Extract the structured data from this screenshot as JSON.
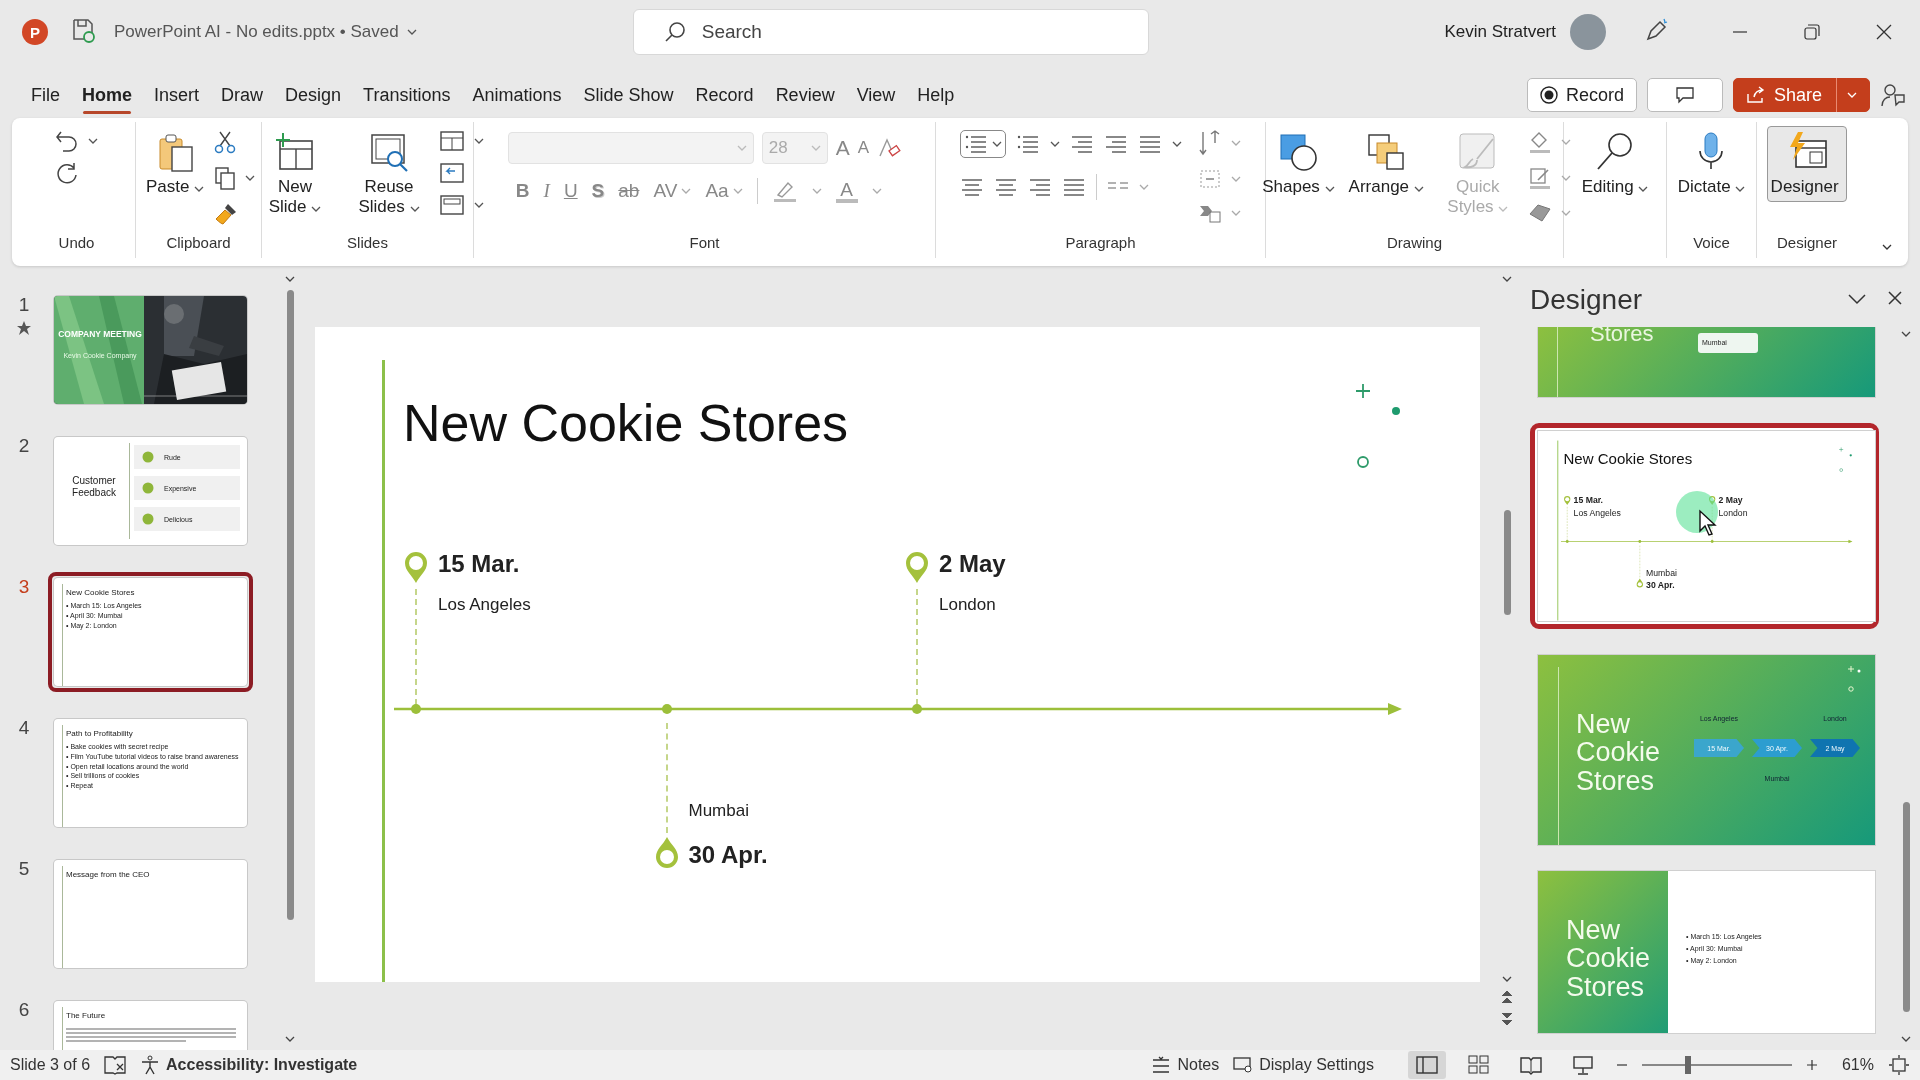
{
  "title_bar": {
    "app_logo": "P",
    "document": "PowerPoint AI - No edits.pptx",
    "status": "• Saved",
    "search_placeholder": "Search",
    "user": "Kevin Stratvert"
  },
  "menu_tabs": [
    {
      "label": "File",
      "selected": false
    },
    {
      "label": "Home",
      "selected": true
    },
    {
      "label": "Insert",
      "selected": false
    },
    {
      "label": "Draw",
      "selected": false
    },
    {
      "label": "Design",
      "selected": false
    },
    {
      "label": "Transitions",
      "selected": false
    },
    {
      "label": "Animations",
      "selected": false
    },
    {
      "label": "Slide Show",
      "selected": false
    },
    {
      "label": "Record",
      "selected": false
    },
    {
      "label": "Review",
      "selected": false
    },
    {
      "label": "View",
      "selected": false
    },
    {
      "label": "Help",
      "selected": false
    }
  ],
  "header_buttons": [
    {
      "kind": "record",
      "label": "Record"
    },
    {
      "kind": "comments"
    },
    {
      "kind": "share",
      "label": "Share"
    }
  ],
  "ribbon": [
    {
      "kind": "undo",
      "label": "Undo"
    },
    {
      "kind": "clipboard",
      "label": "Clipboard",
      "buttons": [
        {
          "label": "Paste"
        }
      ]
    },
    {
      "kind": "slides",
      "label": "Slides",
      "buttons": [
        {
          "label": "New Slide"
        },
        {
          "label": "Reuse Slides"
        }
      ]
    },
    {
      "kind": "font",
      "label": "Font",
      "size": "28",
      "size_buttons": [
        "A",
        "A"
      ],
      "format": [
        "B",
        "I",
        "U",
        "S",
        "ab",
        "AV",
        "Aa"
      ],
      "color_button": "A"
    },
    {
      "kind": "paragraph",
      "label": "Paragraph"
    },
    {
      "kind": "drawing",
      "label": "Drawing",
      "buttons": [
        {
          "label": "Shapes",
          "disabled": false
        },
        {
          "label": "Arrange",
          "disabled": false
        },
        {
          "label": "Quick Styles",
          "disabled": true
        }
      ]
    },
    {
      "kind": "editing",
      "buttons": [
        {
          "label": "Editing"
        }
      ]
    },
    {
      "kind": "voice",
      "label": "Voice",
      "buttons": [
        {
          "label": "Dictate"
        }
      ]
    },
    {
      "kind": "designer",
      "label": "Designer",
      "buttons": [
        {
          "label": "Designer",
          "selected": true
        }
      ]
    }
  ],
  "slides": [
    {
      "number": "1",
      "selected": false,
      "starred": true,
      "title": "COMPANY MEETING",
      "subtitle": "Kevin Cookie Company"
    },
    {
      "number": "2",
      "selected": false,
      "starred": false,
      "kind": "feedback",
      "title": "Customer Feedback",
      "items": [
        "Rude",
        "Expensive",
        "Delicious"
      ]
    },
    {
      "number": "3",
      "selected": true,
      "starred": false,
      "kind": "bullets",
      "title": "New Cookie Stores",
      "bullets": [
        "• March 15: Los Angeles",
        "• April 30: Mumbai",
        "• May 2: London"
      ]
    },
    {
      "number": "4",
      "selected": false,
      "starred": false,
      "kind": "bullets",
      "title": "Path to Profitability",
      "bullets": [
        "• Bake cookies with secret recipe",
        "• Film YouTube tutorial videos to raise brand awareness",
        "• Open retail locations around the world",
        "• Sell trillions of cookies",
        "• Repeat"
      ]
    },
    {
      "number": "5",
      "selected": false,
      "starred": false,
      "kind": "bullets",
      "title": "Message from the CEO"
    },
    {
      "number": "6",
      "selected": false,
      "starred": false,
      "kind": "paragraph",
      "title": "The Future"
    }
  ],
  "main_slide": {
    "title": "New Cookie Stores",
    "events": [
      {
        "date": "15 Mar.",
        "place": "Los Angeles",
        "kind": "above"
      },
      {
        "date": "30 Apr.",
        "place": "Mumbai",
        "kind": "below"
      },
      {
        "date": "2 May",
        "place": "London",
        "kind": "above"
      }
    ]
  },
  "designer": {
    "title": "Designer",
    "designs": [
      {
        "kind": "partial",
        "selected": false,
        "title": "Stores",
        "label": "Mumbai"
      },
      {
        "kind": "timeline",
        "selected": true,
        "title": "New Cookie Stores",
        "events": [
          {
            "date": "15 Mar.",
            "place": "Los Angeles",
            "kind": "above"
          },
          {
            "date": "30 Apr.",
            "place": "Mumbai",
            "kind": "below"
          },
          {
            "date": "2 May",
            "place": "London",
            "kind": "above"
          }
        ]
      },
      {
        "kind": "chevrons",
        "selected": false,
        "title": "New Cookie Stores",
        "events": [
          {
            "date": "15 Mar.",
            "place": "Los Angeles",
            "kind": "above"
          },
          {
            "date": "30 Apr.",
            "place": "Mumbai",
            "kind": "below"
          },
          {
            "date": "2 May",
            "place": "London",
            "kind": "above"
          }
        ]
      },
      {
        "kind": "split",
        "selected": false,
        "title": "New Cookie Stores",
        "bullets": [
          "• March 15: Los Angeles",
          "• April 30: Mumbai",
          "• May 2: London"
        ]
      }
    ]
  },
  "status_bar": {
    "slide_info": "Slide 3 of 6",
    "accessibility": "Accessibility: Investigate",
    "notes": "Notes",
    "display_settings": "Display Settings",
    "views": [
      {
        "kind": "normal",
        "selected": true
      },
      {
        "kind": "sorter",
        "selected": false
      },
      {
        "kind": "reading",
        "selected": false
      },
      {
        "kind": "slideshow",
        "selected": false
      }
    ],
    "zoom": {
      "level": 0.31,
      "percent": "61%"
    }
  }
}
